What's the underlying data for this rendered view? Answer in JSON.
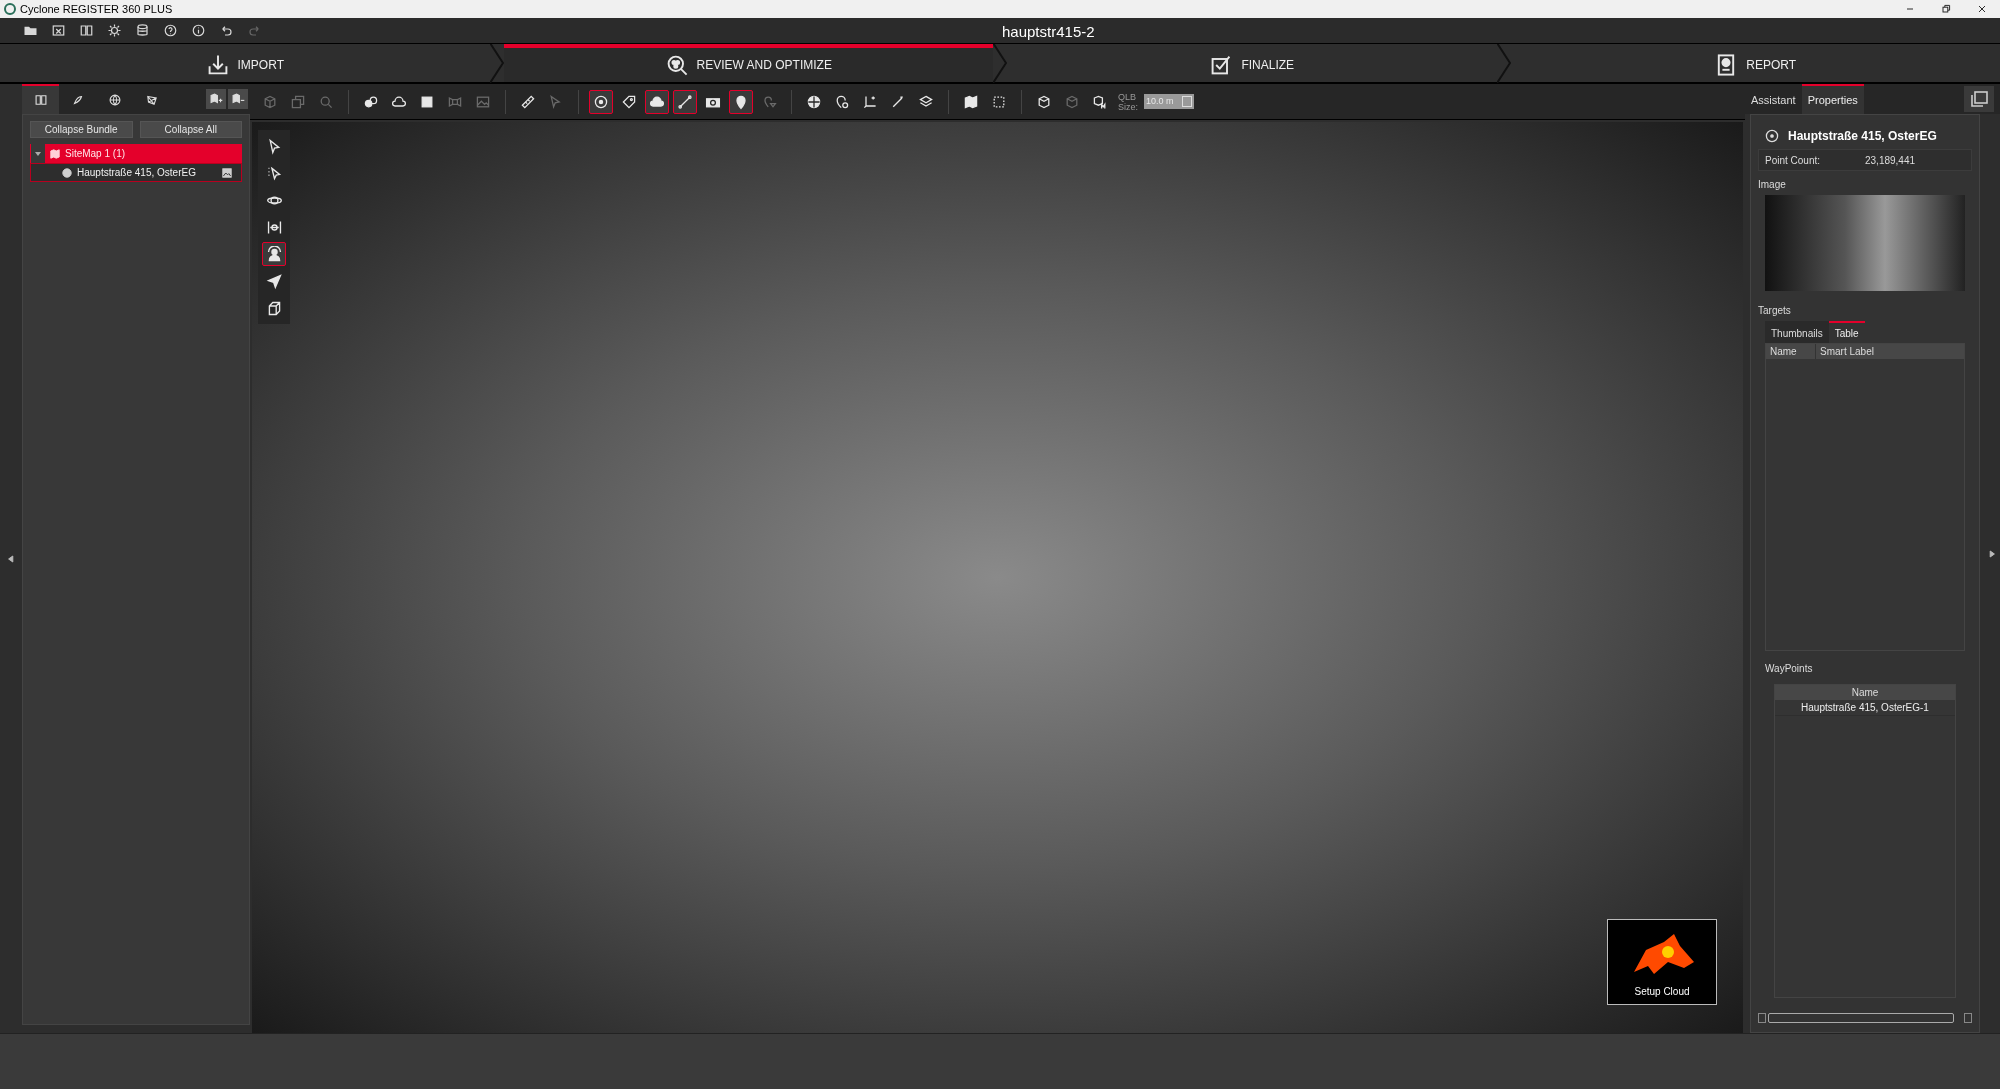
{
  "window": {
    "title": "Cyclone REGISTER 360 PLUS"
  },
  "menu_bar": {
    "project_title": "hauptstr415-2",
    "icons": [
      {
        "disabled": false
      },
      {
        "disabled": false
      },
      {
        "disabled": false
      },
      {
        "disabled": false
      },
      {
        "disabled": false
      },
      {
        "disabled": false
      },
      {
        "disabled": false
      },
      {
        "disabled": false
      },
      {
        "disabled": true
      }
    ]
  },
  "workflow_steps": [
    {
      "label": "IMPORT",
      "selected": false
    },
    {
      "label": "REVIEW AND OPTIMIZE",
      "selected": true
    },
    {
      "label": "FINALIZE",
      "selected": false
    },
    {
      "label": "REPORT",
      "selected": false
    }
  ],
  "left_panel": {
    "tabs": [
      {
        "selected": true
      },
      {
        "selected": false
      },
      {
        "selected": false
      },
      {
        "selected": false
      }
    ],
    "buttons": [
      "Collapse Bundle",
      "Collapse All"
    ],
    "tree": [
      {
        "label": "SiteMap 1 (1)",
        "expanded": true,
        "selected": true,
        "focused": false,
        "children": [
          {
            "label": "Hauptstraße 415, OsterEG",
            "selected": false,
            "focused": true
          }
        ]
      }
    ]
  },
  "toolbar": {
    "groups": [
      [
        {
          "selected": false,
          "disabled": true
        },
        {
          "selected": false,
          "disabled": true
        },
        {
          "selected": false,
          "disabled": true
        }
      ],
      [
        {
          "selected": false,
          "disabled": false
        },
        {
          "selected": false,
          "disabled": false
        },
        {
          "selected": false,
          "disabled": false
        },
        {
          "selected": false,
          "disabled": true
        },
        {
          "selected": false,
          "disabled": true
        }
      ],
      [
        {
          "selected": false,
          "disabled": false
        },
        {
          "selected": false,
          "disabled": true
        }
      ],
      [
        {
          "selected": true,
          "disabled": false
        },
        {
          "selected": false,
          "disabled": false
        },
        {
          "selected": true,
          "disabled": false
        },
        {
          "selected": true,
          "disabled": false
        },
        {
          "selected": false,
          "disabled": false
        },
        {
          "selected": true,
          "disabled": false
        },
        {
          "selected": false,
          "disabled": true
        }
      ],
      [
        {
          "selected": false,
          "disabled": false
        },
        {
          "selected": false,
          "disabled": false
        },
        {
          "selected": false,
          "disabled": false
        },
        {
          "selected": false,
          "disabled": false
        },
        {
          "selected": false,
          "disabled": false
        }
      ],
      [
        {
          "selected": false,
          "disabled": false
        },
        {
          "selected": false,
          "disabled": false
        }
      ],
      [
        {
          "selected": false,
          "disabled": false
        },
        {
          "selected": false,
          "disabled": true
        },
        {
          "selected": false,
          "disabled": false
        }
      ]
    ],
    "qlb_label": "QLB",
    "size_label": "Size:",
    "size_value": "10.0 m"
  },
  "viewport": {
    "tools": [
      {
        "selected": false
      },
      {
        "selected": false
      },
      {
        "selected": false
      },
      {
        "selected": false
      },
      {
        "selected": true
      },
      {
        "selected": false
      },
      {
        "selected": false
      }
    ],
    "setup_cloud": {
      "label": "Setup Cloud"
    }
  },
  "right_panel": {
    "tabs": [
      {
        "label": "Assistant",
        "selected": false
      },
      {
        "label": "Properties",
        "selected": true
      }
    ],
    "properties": {
      "title": "Hauptstraße 415, OsterEG",
      "fields": [
        {
          "label": "Point Count:",
          "value": "23,189,441"
        }
      ],
      "image_label": "Image",
      "targets": {
        "label": "Targets",
        "tabs": [
          {
            "label": "Thumbnails",
            "selected": false
          },
          {
            "label": "Table",
            "selected": true
          }
        ],
        "columns": [
          "Name",
          "Smart Label"
        ]
      },
      "waypoints": {
        "label": "WayPoints",
        "columns": [
          "Name"
        ],
        "rows": [
          [
            "Hauptstraße 415, OsterEG-1"
          ]
        ]
      }
    }
  }
}
